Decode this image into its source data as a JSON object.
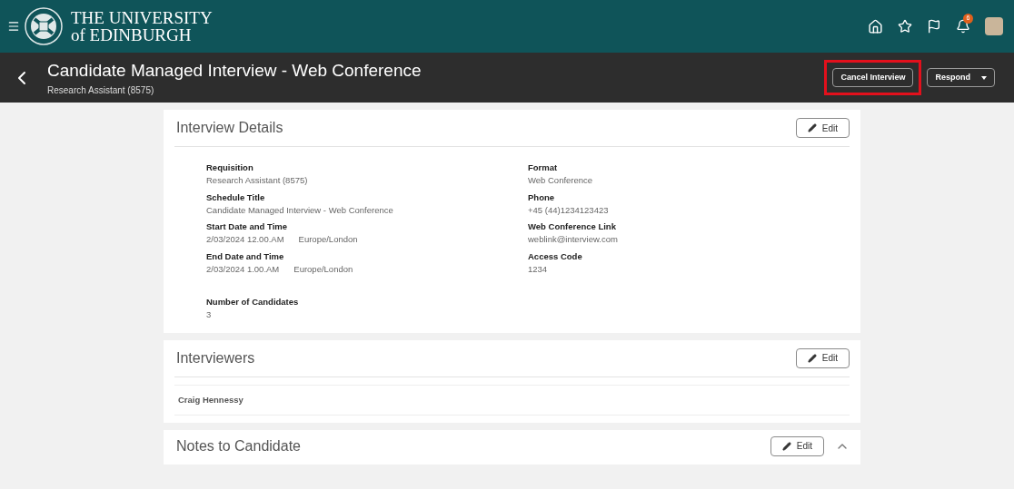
{
  "header": {
    "logo_line_1": "THE UNIVERSITY",
    "logo_line_2": "of EDINBURGH",
    "notification_count": "6"
  },
  "title_bar": {
    "title": "Candidate Managed Interview - Web Conference",
    "subtitle": "Research Assistant (8575)",
    "buttons": [
      {
        "label": "Cancel Interview",
        "kind": "plain",
        "highlighted": true
      },
      {
        "label": "Respond",
        "kind": "menu",
        "highlighted": false
      }
    ]
  },
  "interview_details": {
    "title": "Interview Details",
    "edit_label": "Edit",
    "left_fields": [
      {
        "label": "Requisition",
        "value": "Research Assistant (8575)"
      },
      {
        "label": "Schedule Title",
        "value": "Candidate Managed Interview - Web Conference"
      },
      {
        "label": "Start Date and Time",
        "value": "2/03/2024 12.00.AM",
        "zone": "Europe/London"
      },
      {
        "label": "End Date and Time",
        "value": "2/03/2024 1.00.AM",
        "zone": "Europe/London"
      }
    ],
    "right_fields": [
      {
        "label": "Format",
        "value": "Web Conference"
      },
      {
        "label": "Phone",
        "value": "+45 (44)1234123423"
      },
      {
        "label": "Web Conference Link",
        "value": "weblink@interview.com"
      },
      {
        "label": "Access Code",
        "value": "1234"
      }
    ],
    "candidates": {
      "label": "Number of Candidates",
      "value": "3"
    }
  },
  "interviewers": {
    "title": "Interviewers",
    "edit_label": "Edit",
    "names": [
      "Craig Hennessy"
    ]
  },
  "notes": {
    "title": "Notes to Candidate",
    "edit_label": "Edit",
    "expanded": true
  }
}
